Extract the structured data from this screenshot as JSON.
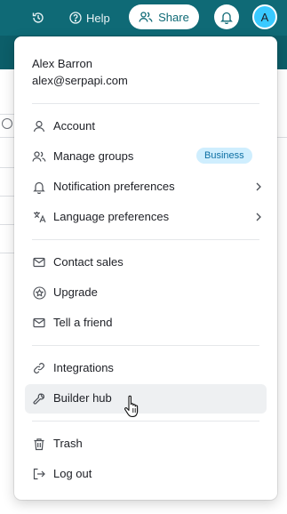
{
  "topbar": {
    "history_icon": "history-icon",
    "help_label": "Help",
    "share_label": "Share",
    "bell_icon": "bell-icon",
    "avatar_initial": "A",
    "colors": {
      "bar": "#0f6a76",
      "avatar": "#39caff"
    }
  },
  "user": {
    "name": "Alex Barron",
    "email": "alex@serpapi.com"
  },
  "menu": {
    "account": "Account",
    "manage_groups": "Manage groups",
    "business_badge": "Business",
    "notification_preferences": "Notification preferences",
    "language_preferences": "Language preferences",
    "contact_sales": "Contact sales",
    "upgrade": "Upgrade",
    "tell_a_friend": "Tell a friend",
    "integrations": "Integrations",
    "builder_hub": "Builder hub",
    "trash": "Trash",
    "log_out": "Log out"
  }
}
